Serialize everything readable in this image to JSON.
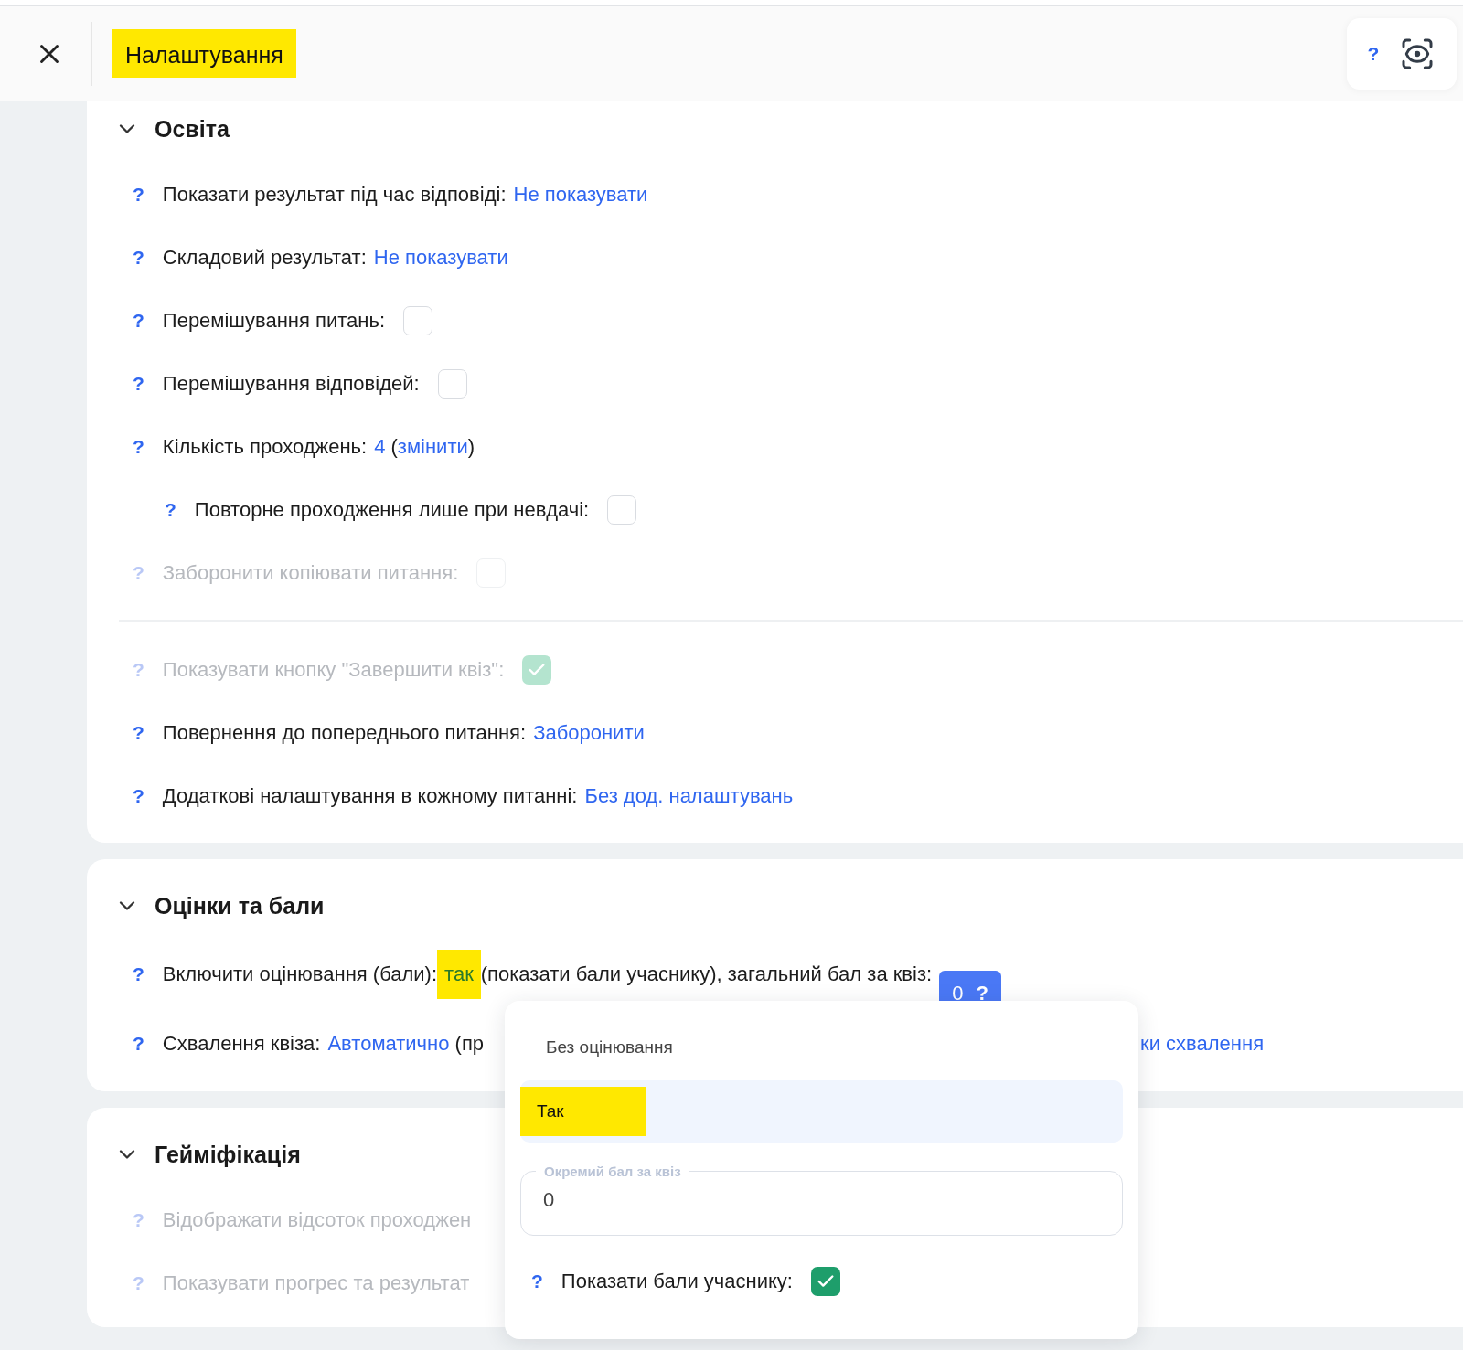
{
  "header": {
    "title": "Налаштування",
    "title_highlighted": true,
    "help": "?"
  },
  "sections": [
    {
      "title": "Освіта",
      "expanded": true,
      "rows": [
        {
          "kind": "setting",
          "help": "?",
          "label": "Показати результат під час відповіді:",
          "disabled": false,
          "indented": false,
          "segments": [
            {
              "kind": "link",
              "text": "Не показувати"
            }
          ]
        },
        {
          "kind": "setting",
          "help": "?",
          "label": "Складовий результат:",
          "disabled": false,
          "indented": false,
          "segments": [
            {
              "kind": "link",
              "text": "Не показувати"
            }
          ]
        },
        {
          "kind": "setting",
          "help": "?",
          "label": "Перемішування питань:",
          "disabled": false,
          "indented": false,
          "checkbox": {
            "checked": false
          }
        },
        {
          "kind": "setting",
          "help": "?",
          "label": "Перемішування відповідей:",
          "disabled": false,
          "indented": false,
          "checkbox": {
            "checked": false
          }
        },
        {
          "kind": "setting",
          "help": "?",
          "label": "Кількість проходжень:",
          "disabled": false,
          "indented": false,
          "segments": [
            {
              "kind": "link",
              "text": "4"
            },
            {
              "kind": "text",
              "text": " ("
            },
            {
              "kind": "link",
              "text": "змінити"
            },
            {
              "kind": "text",
              "text": ")"
            }
          ]
        },
        {
          "kind": "setting",
          "help": "?",
          "label": "Повторне проходження лише при невдачі:",
          "disabled": false,
          "indented": true,
          "checkbox": {
            "checked": false
          }
        },
        {
          "kind": "setting",
          "help": "?",
          "label": "Заборонити копіювати питання:",
          "disabled": true,
          "indented": false,
          "checkbox": {
            "checked": false
          }
        },
        {
          "kind": "divider"
        },
        {
          "kind": "setting",
          "help": "?",
          "label": "Показувати кнопку \"Завершити квіз\":",
          "disabled": true,
          "indented": false,
          "checkbox": {
            "checked": true
          }
        },
        {
          "kind": "setting",
          "help": "?",
          "label": "Повернення до попереднього питання:",
          "disabled": false,
          "indented": false,
          "segments": [
            {
              "kind": "link",
              "text": "Заборонити"
            }
          ]
        },
        {
          "kind": "setting",
          "help": "?",
          "label": "Додаткові налаштування в кожному питанні:",
          "disabled": false,
          "indented": false,
          "segments": [
            {
              "kind": "link",
              "text": "Без дод. налаштувань"
            }
          ]
        }
      ]
    },
    {
      "title": "Оцінки та бали",
      "expanded": true,
      "rows": [
        {
          "kind": "setting",
          "help": "?",
          "label": "Включити оцінювання (бали):",
          "disabled": false,
          "indented": false,
          "segments": [
            {
              "kind": "answer",
              "text": "так",
              "highlighted": true
            },
            {
              "kind": "text",
              "text": "(показати бали учаснику), загальний бал за квіз:"
            },
            {
              "kind": "badge",
              "text": "0",
              "help": "?"
            }
          ]
        },
        {
          "kind": "setting",
          "help": "?",
          "label": "Схвалення квіза:",
          "disabled": false,
          "indented": false,
          "segments": [
            {
              "kind": "link",
              "text": "Автоматично"
            },
            {
              "kind": "text",
              "text": " (пр"
            },
            {
              "kind": "link",
              "text": "ки схвалення",
              "after_popup": true
            }
          ]
        }
      ]
    },
    {
      "title": "Гейміфікація",
      "expanded": true,
      "rows": [
        {
          "kind": "setting",
          "help": "?",
          "label": "Відображати відсоток проходжен",
          "disabled": true,
          "indented": false
        },
        {
          "kind": "setting",
          "help": "?",
          "label": "Показувати прогрес та результат",
          "disabled": true,
          "indented": false
        }
      ]
    }
  ],
  "popup": {
    "options": [
      {
        "label": "Без оцінювання",
        "selected": false,
        "highlighted": false
      },
      {
        "label": "Так",
        "selected": true,
        "highlighted": true
      }
    ],
    "field": {
      "label": "Окремий бал за квіз",
      "value": "0"
    },
    "toggle": {
      "help": "?",
      "label": "Показати бали учаснику:",
      "checked": true
    }
  }
}
